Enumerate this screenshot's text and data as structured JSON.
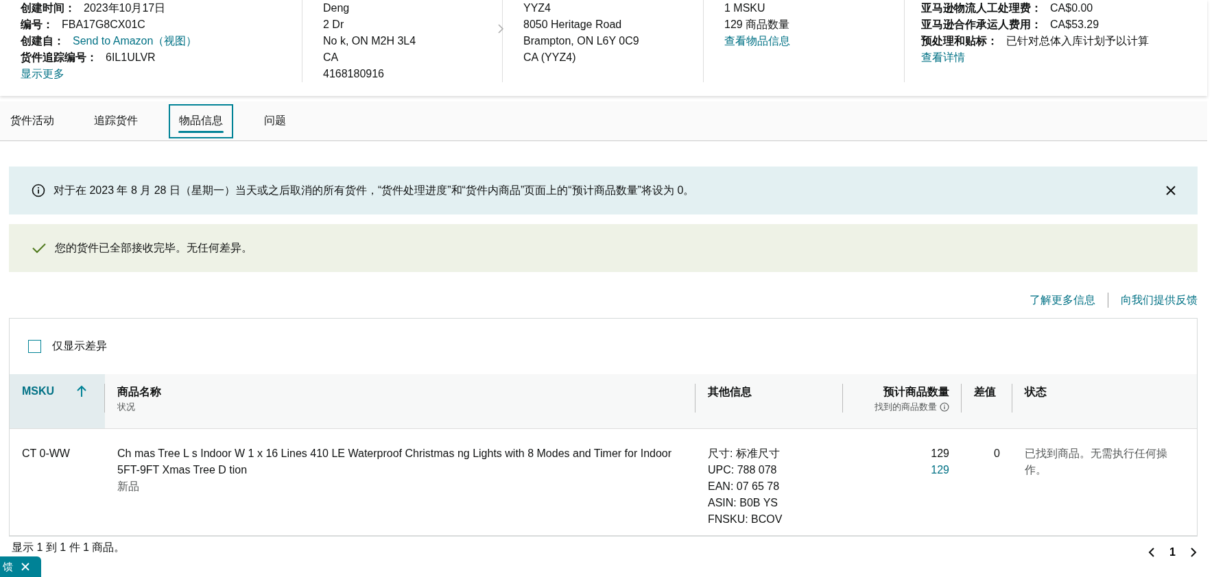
{
  "summary": {
    "shipment": {
      "fields": [
        {
          "label": "创建时间：",
          "value": "2023年10月17日",
          "link": false
        },
        {
          "label": "编号：",
          "value": "FBA17G8CX01C",
          "link": false
        },
        {
          "label": "创建自：",
          "value": "Send to Amazon（视图）",
          "link": true
        },
        {
          "label": "货件追踪编号：",
          "value": "6IL1ULVR",
          "link": false
        }
      ],
      "more_link": "显示更多"
    },
    "ship_from": {
      "lines": [
        "Deng",
        "2  Dr",
        "No  k, ON M2H 3L4",
        "CA",
        "4168180916"
      ]
    },
    "ship_to": {
      "lines": [
        "YYZ4",
        "8050 Heritage Road",
        "Brampton, ON L6Y 0C9",
        "CA (YYZ4)"
      ]
    },
    "contents": {
      "lines": [
        "1 MSKU",
        "129 商品数量"
      ],
      "link": "查看物品信息"
    },
    "fees": {
      "fields": [
        {
          "label": "亚马逊物流人工处理费：",
          "value": "CA$0.00"
        },
        {
          "label": "亚马逊合作承运人费用：",
          "value": "CA$53.29"
        },
        {
          "label": "预处理和贴标：",
          "value": "已针对总体入库计划予以计算"
        }
      ],
      "link": "查看详情"
    }
  },
  "tabs": [
    {
      "label": "货件活动",
      "selected": false
    },
    {
      "label": "追踪货件",
      "selected": false
    },
    {
      "label": "物品信息",
      "selected": true
    },
    {
      "label": "问题",
      "selected": false
    }
  ],
  "notice": {
    "text": "对于在 2023 年 8 月 28 日（星期一）当天或之后取消的所有货件，“货件处理进度”和“货件内商品”页面上的“预计商品数量”将设为 0。"
  },
  "success": {
    "text": "您的货件已全部接收完毕。无任何差异。"
  },
  "links": [
    "了解更多信息",
    "向我们提供反馈"
  ],
  "table": {
    "filter": {
      "label": "仅显示差异",
      "checked": false
    },
    "columns": [
      {
        "title": "MSKU",
        "sorted": true,
        "kind": "text"
      },
      {
        "title": "商品名称",
        "subtitle": "状况",
        "sorted": false,
        "kind": "text"
      },
      {
        "title": "其他信息",
        "sorted": false,
        "kind": "text"
      },
      {
        "title": "预计商品数量",
        "subtitle": "找到的商品数量",
        "info": true,
        "sorted": false,
        "kind": "number"
      },
      {
        "title": "差值",
        "sorted": false,
        "kind": "text"
      },
      {
        "title": "状态",
        "sorted": false,
        "kind": "text"
      }
    ],
    "rows": [
      {
        "msku": "CT  0-WW",
        "name": "Ch  mas Tree L  s Indoor W  1 x 16 Lines 410 LE  Waterproof Christmas  ng Lights with 8 Modes and Timer for Indoor 5FT-9FT Xmas Tree D  tion",
        "condition": "新品",
        "other": [
          "尺寸: 标准尺寸",
          "UPC: 788  078",
          "EAN: 07  65  78",
          "ASIN: B0B  YS",
          "FNSKU:  BCOV"
        ],
        "expected": "129",
        "found": "129",
        "difference": "0",
        "status": "已找到商品。无需执行任何操作。"
      }
    ],
    "footer": "显示 1 到 1 件 1 商品。"
  },
  "pagination": {
    "pages": [
      {
        "label": "1",
        "selected": true
      }
    ]
  },
  "feedback_tab": {
    "label": "馈"
  }
}
